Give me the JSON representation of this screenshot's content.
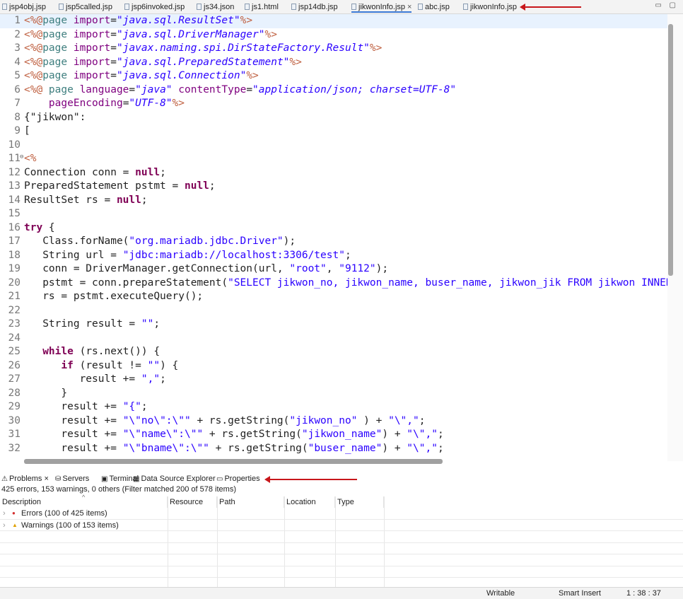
{
  "tabs": [
    {
      "label": "jsp4obj.jsp",
      "active": false
    },
    {
      "label": "jsp5called.jsp",
      "active": false
    },
    {
      "label": "jsp6invoked.jsp",
      "active": false
    },
    {
      "label": "js34.json",
      "active": false
    },
    {
      "label": "js1.html",
      "active": false
    },
    {
      "label": "jsp14db.jsp",
      "active": false
    },
    {
      "label": "jikwonInfo.jsp",
      "active": true,
      "close": "×"
    },
    {
      "label": "abc.jsp",
      "active": false
    },
    {
      "label": "jikwonInfo.jsp",
      "active": false
    }
  ],
  "window_controls": "▭ ▢",
  "code_lines": [
    {
      "n": "1",
      "current": true,
      "tokens": [
        [
          "dir",
          "<%@"
        ],
        [
          "pg",
          "page "
        ],
        [
          "att",
          "import"
        ],
        [
          "",
          "="
        ],
        [
          "ital",
          "\"java.sql.ResultSet\""
        ],
        [
          "dir",
          "%>"
        ]
      ]
    },
    {
      "n": "2",
      "tokens": [
        [
          "dir",
          "<%@"
        ],
        [
          "pg",
          "page "
        ],
        [
          "att",
          "import"
        ],
        [
          "",
          "="
        ],
        [
          "ital",
          "\"java.sql.DriverManager\""
        ],
        [
          "dir",
          "%>"
        ]
      ]
    },
    {
      "n": "3",
      "tokens": [
        [
          "dir",
          "<%@"
        ],
        [
          "pg",
          "page "
        ],
        [
          "att",
          "import"
        ],
        [
          "",
          "="
        ],
        [
          "ital",
          "\"javax.naming.spi.DirStateFactory.Result\""
        ],
        [
          "dir",
          "%>"
        ]
      ]
    },
    {
      "n": "4",
      "tokens": [
        [
          "dir",
          "<%@"
        ],
        [
          "pg",
          "page "
        ],
        [
          "att",
          "import"
        ],
        [
          "",
          "="
        ],
        [
          "ital",
          "\"java.sql.PreparedStatement\""
        ],
        [
          "dir",
          "%>"
        ]
      ]
    },
    {
      "n": "5",
      "tokens": [
        [
          "dir",
          "<%@"
        ],
        [
          "pg",
          "page "
        ],
        [
          "att",
          "import"
        ],
        [
          "",
          "="
        ],
        [
          "ital",
          "\"java.sql.Connection\""
        ],
        [
          "dir",
          "%>"
        ]
      ]
    },
    {
      "n": "6",
      "tokens": [
        [
          "dir",
          "<%@ "
        ],
        [
          "pg",
          "page "
        ],
        [
          "att",
          "language"
        ],
        [
          "",
          "="
        ],
        [
          "ital",
          "\"java\""
        ],
        [
          "",
          " "
        ],
        [
          "att",
          "contentType"
        ],
        [
          "",
          "="
        ],
        [
          "ital",
          "\"application/json; charset=UTF-8\""
        ]
      ]
    },
    {
      "n": "7",
      "tokens": [
        [
          "",
          "    "
        ],
        [
          "att",
          "pageEncoding"
        ],
        [
          "",
          "="
        ],
        [
          "ital",
          "\"UTF-8\""
        ],
        [
          "dir",
          "%>"
        ]
      ]
    },
    {
      "n": "8",
      "tokens": [
        [
          "",
          "{\"jikwon\":"
        ]
      ]
    },
    {
      "n": "9",
      "tokens": [
        [
          "",
          "["
        ]
      ]
    },
    {
      "n": "10",
      "tokens": []
    },
    {
      "n": "11",
      "fold": "⊖",
      "tokens": [
        [
          "dir",
          "<%"
        ]
      ]
    },
    {
      "n": "12",
      "tokens": [
        [
          "",
          "Connection conn = "
        ],
        [
          "kw",
          "null"
        ],
        [
          "",
          ";"
        ]
      ]
    },
    {
      "n": "13",
      "tokens": [
        [
          "",
          "PreparedStatement pstmt = "
        ],
        [
          "kw",
          "null"
        ],
        [
          "",
          ";"
        ]
      ]
    },
    {
      "n": "14",
      "tokens": [
        [
          "",
          "ResultSet rs = "
        ],
        [
          "kw",
          "null"
        ],
        [
          "",
          ";"
        ]
      ]
    },
    {
      "n": "15",
      "tokens": []
    },
    {
      "n": "16",
      "tokens": [
        [
          "kw",
          "try"
        ],
        [
          "",
          " {"
        ]
      ]
    },
    {
      "n": "17",
      "tokens": [
        [
          "",
          "   Class.forName("
        ],
        [
          "str",
          "\"org.mariadb.jdbc.Driver\""
        ],
        [
          "",
          ");"
        ]
      ]
    },
    {
      "n": "18",
      "tokens": [
        [
          "",
          "   String url = "
        ],
        [
          "str",
          "\"jdbc:mariadb://localhost:3306/test\""
        ],
        [
          "",
          ";"
        ]
      ]
    },
    {
      "n": "19",
      "tokens": [
        [
          "",
          "   conn = DriverManager.getConnection(url, "
        ],
        [
          "str",
          "\"root\""
        ],
        [
          "",
          ", "
        ],
        [
          "str",
          "\"9112\""
        ],
        [
          "",
          ");"
        ]
      ]
    },
    {
      "n": "20",
      "tokens": [
        [
          "",
          "   pstmt = conn.prepareStatement("
        ],
        [
          "str",
          "\"SELECT jikwon_no, jikwon_name, buser_name, jikwon_jik FROM jikwon INNER"
        ]
      ]
    },
    {
      "n": "21",
      "tokens": [
        [
          "",
          "   rs = pstmt.executeQuery();"
        ]
      ]
    },
    {
      "n": "22",
      "tokens": []
    },
    {
      "n": "23",
      "tokens": [
        [
          "",
          "   String result = "
        ],
        [
          "str",
          "\"\""
        ],
        [
          "",
          ";"
        ]
      ]
    },
    {
      "n": "24",
      "tokens": []
    },
    {
      "n": "25",
      "tokens": [
        [
          "",
          "   "
        ],
        [
          "kw",
          "while"
        ],
        [
          "",
          " (rs.next()) {"
        ]
      ]
    },
    {
      "n": "26",
      "tokens": [
        [
          "",
          "      "
        ],
        [
          "kw",
          "if"
        ],
        [
          "",
          " (result != "
        ],
        [
          "str",
          "\"\""
        ],
        [
          "",
          ") {"
        ]
      ]
    },
    {
      "n": "27",
      "tokens": [
        [
          "",
          "         result += "
        ],
        [
          "str",
          "\",\""
        ],
        [
          "",
          ";"
        ]
      ]
    },
    {
      "n": "28",
      "tokens": [
        [
          "",
          "      }"
        ]
      ]
    },
    {
      "n": "29",
      "tokens": [
        [
          "",
          "      result += "
        ],
        [
          "str",
          "\"{\""
        ],
        [
          "",
          ";"
        ]
      ]
    },
    {
      "n": "30",
      "tokens": [
        [
          "",
          "      result += "
        ],
        [
          "str",
          "\"\\\"no\\\":\\\"\""
        ],
        [
          "",
          " + rs.getString("
        ],
        [
          "str",
          "\"jikwon_no\""
        ],
        [
          "",
          " ) + "
        ],
        [
          "str",
          "\"\\\",\""
        ],
        [
          "",
          ";"
        ]
      ]
    },
    {
      "n": "31",
      "tokens": [
        [
          "",
          "      result += "
        ],
        [
          "str",
          "\"\\\"name\\\":\\\"\""
        ],
        [
          "",
          " + rs.getString("
        ],
        [
          "str",
          "\"jikwon_name\""
        ],
        [
          "",
          ") + "
        ],
        [
          "str",
          "\"\\\",\""
        ],
        [
          "",
          ";"
        ]
      ]
    },
    {
      "n": "32",
      "tokens": [
        [
          "",
          "      result += "
        ],
        [
          "str",
          "\"\\\"bname\\\":\\\"\""
        ],
        [
          "",
          " + rs.getString("
        ],
        [
          "str",
          "\"buser_name\""
        ],
        [
          "",
          ") + "
        ],
        [
          "str",
          "\"\\\",\""
        ],
        [
          "",
          ";"
        ]
      ]
    }
  ],
  "view_tabs": [
    {
      "label": "Problems",
      "icon": "problems-icon",
      "glyph": "⚠",
      "close": "×",
      "active": true
    },
    {
      "label": "Servers",
      "icon": "servers-icon",
      "glyph": "⛁"
    },
    {
      "label": "Terminal",
      "icon": "terminal-icon",
      "glyph": "▣"
    },
    {
      "label": "Data Source Explorer",
      "icon": "data-source-icon",
      "glyph": "▦"
    },
    {
      "label": "Properties",
      "icon": "properties-icon",
      "glyph": "▭"
    }
  ],
  "problems": {
    "summary": "425 errors, 153 warnings, 0 others (Filter matched 200 of 578 items)",
    "columns": [
      "Description",
      "Resource",
      "Path",
      "Location",
      "Type"
    ],
    "sort_indicator": "^",
    "rows": [
      {
        "label": "Errors (100 of 425 items)",
        "kind": "error",
        "color": "#d32f2f"
      },
      {
        "label": "Warnings (100 of 153 items)",
        "kind": "warning",
        "color": "#e0a000"
      }
    ]
  },
  "status": {
    "writable": "Writable",
    "insert_mode": "Smart Insert",
    "position": "1 : 38 : 37"
  },
  "colors": {
    "arrow": "#c8171b",
    "keyword": "#7f0055",
    "string": "#2a00ff",
    "directive": "#bf5f3f"
  }
}
